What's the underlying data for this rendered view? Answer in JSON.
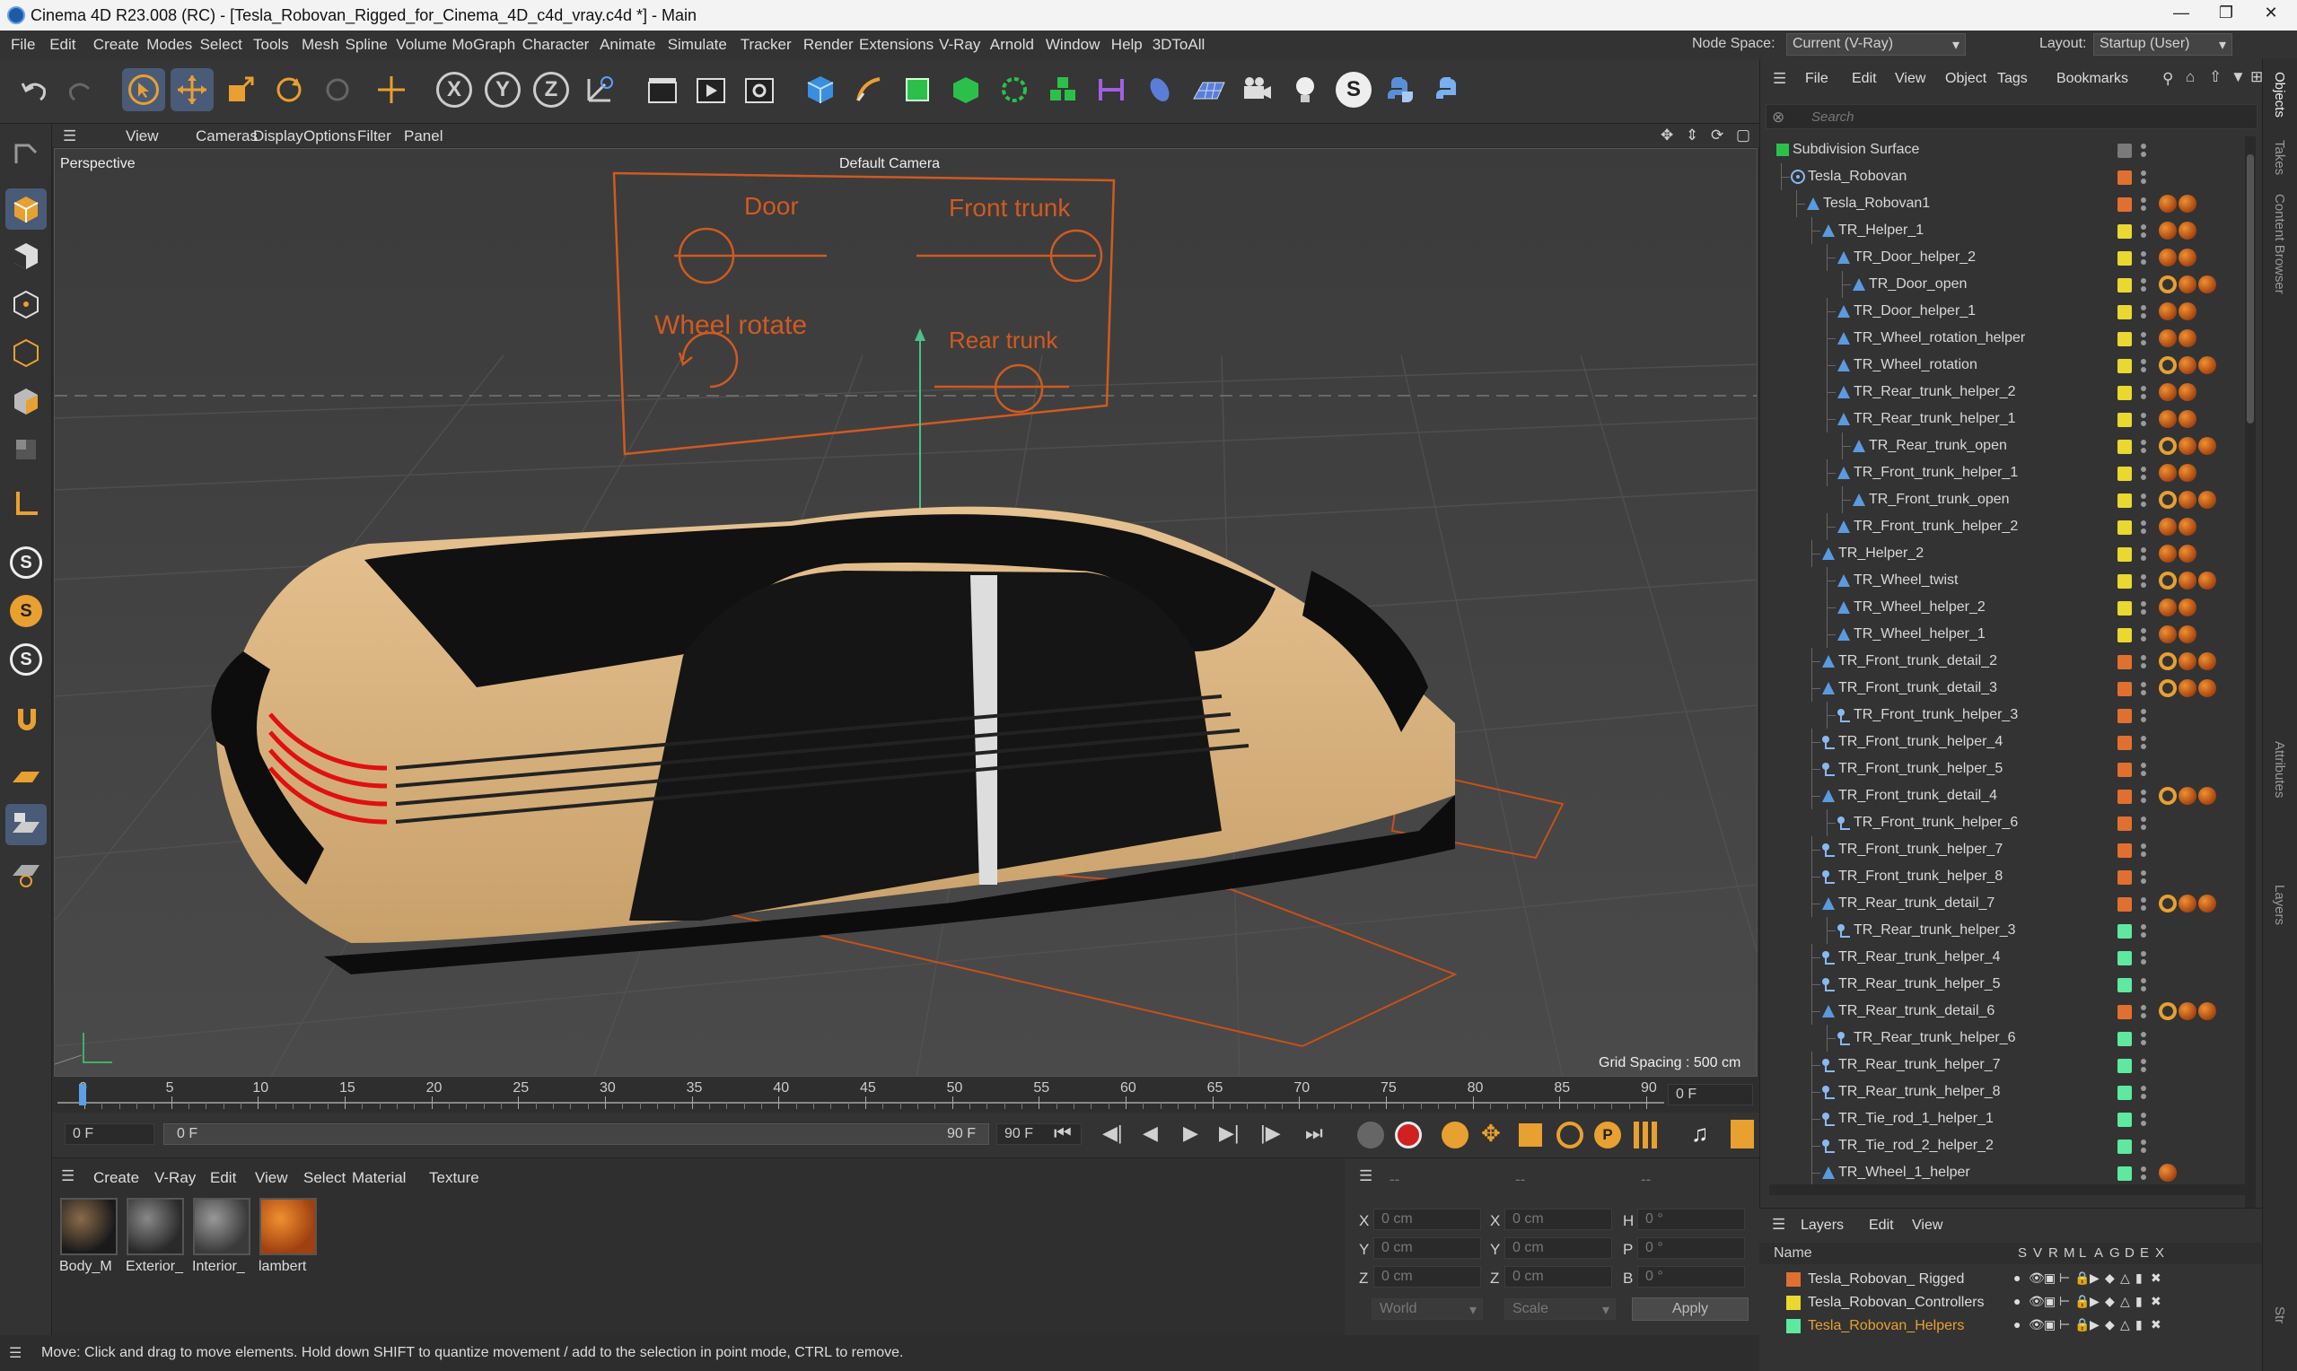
{
  "window": {
    "title": "Cinema 4D R23.008 (RC) - [Tesla_Robovan_Rigged_for_Cinema_4D_c4d_vray.c4d *] - Main"
  },
  "menu": [
    "File",
    "Edit",
    "Create",
    "Modes",
    "Select",
    "Tools",
    "Mesh",
    "Spline",
    "Volume",
    "MoGraph",
    "Character",
    "Animate",
    "Simulate",
    "Tracker",
    "Render",
    "Extensions",
    "V-Ray",
    "Arnold",
    "Window",
    "Help",
    "3DToAll"
  ],
  "nodespace": {
    "label": "Node Space:",
    "value": "Current (V-Ray)"
  },
  "layout": {
    "label": "Layout:",
    "value": "Startup (User)"
  },
  "viewport": {
    "menu": [
      "View",
      "Cameras",
      "Display",
      "Options",
      "Filter",
      "Panel"
    ],
    "name": "Perspective",
    "camera": "Default Camera",
    "grid_spacing": "Grid Spacing : 500 cm"
  },
  "controller": {
    "door": "Door",
    "front_trunk": "Front trunk",
    "wheel_rotate": "Wheel rotate",
    "rear_trunk": "Rear trunk"
  },
  "timeline": {
    "ticks": [
      "0",
      "5",
      "10",
      "15",
      "20",
      "25",
      "30",
      "35",
      "40",
      "45",
      "50",
      "55",
      "60",
      "65",
      "70",
      "75",
      "80",
      "85",
      "90"
    ],
    "current": "0 F"
  },
  "playback": {
    "start": "0 F",
    "range_start": "0 F",
    "range_end": "90 F",
    "end": "90 F"
  },
  "materials": {
    "menu": [
      "Create",
      "V-Ray",
      "Edit",
      "View",
      "Select",
      "Material",
      "Texture"
    ],
    "items": [
      {
        "name": "Body_M"
      },
      {
        "name": "Exterior_"
      },
      {
        "name": "Interior_"
      },
      {
        "name": "lambert"
      }
    ]
  },
  "coords": {
    "dash1": "--",
    "dash2": "--",
    "dash3": "--",
    "x": "X",
    "y": "Y",
    "z": "Z",
    "h": "H",
    "p": "P",
    "b": "B",
    "pos_x": "0 cm",
    "pos_y": "0 cm",
    "pos_z": "0 cm",
    "sx": "0 cm",
    "sy": "0 cm",
    "sz": "0 cm",
    "rh": "0 °",
    "rp": "0 °",
    "rb": "0 °",
    "world": "World",
    "scale": "Scale",
    "apply": "Apply"
  },
  "status": "Move: Click and drag to move elements. Hold down SHIFT to quantize movement / add to the selection in point mode, CTRL to remove.",
  "objects": {
    "menu": [
      "File",
      "Edit",
      "View",
      "Object",
      "Tags",
      "Bookmarks"
    ],
    "search": "Search",
    "rows": [
      {
        "name": "Subdivision Surface",
        "indent": 0,
        "icon": "subd",
        "layer": "#7a7a7a"
      },
      {
        "name": "Tesla_Robovan",
        "indent": 1,
        "icon": "null",
        "layer": "#e07030"
      },
      {
        "name": "Tesla_Robovan1",
        "indent": 2,
        "icon": "joint",
        "layer": "#e07030",
        "tags": 2
      },
      {
        "name": "TR_Helper_1",
        "indent": 3,
        "icon": "joint",
        "layer": "#e8d830",
        "tags": 2
      },
      {
        "name": "TR_Door_helper_2",
        "indent": 4,
        "icon": "joint",
        "layer": "#e8d830",
        "tags": 2
      },
      {
        "name": "TR_Door_open",
        "indent": 5,
        "icon": "joint",
        "layer": "#e8d830",
        "tags": 3
      },
      {
        "name": "TR_Door_helper_1",
        "indent": 4,
        "icon": "joint",
        "layer": "#e8d830",
        "tags": 2
      },
      {
        "name": "TR_Wheel_rotation_helper",
        "indent": 4,
        "icon": "joint",
        "layer": "#e8d830",
        "tags": 2
      },
      {
        "name": "TR_Wheel_rotation",
        "indent": 4,
        "icon": "joint",
        "layer": "#e8d830",
        "tags": 3
      },
      {
        "name": "TR_Rear_trunk_helper_2",
        "indent": 4,
        "icon": "joint",
        "layer": "#e8d830",
        "tags": 2
      },
      {
        "name": "TR_Rear_trunk_helper_1",
        "indent": 4,
        "icon": "joint",
        "layer": "#e8d830",
        "tags": 2
      },
      {
        "name": "TR_Rear_trunk_open",
        "indent": 5,
        "icon": "joint",
        "layer": "#e8d830",
        "tags": 3
      },
      {
        "name": "TR_Front_trunk_helper_1",
        "indent": 4,
        "icon": "joint",
        "layer": "#e8d830",
        "tags": 2
      },
      {
        "name": "TR_Front_trunk_open",
        "indent": 5,
        "icon": "joint",
        "layer": "#e8d830",
        "tags": 3
      },
      {
        "name": "TR_Front_trunk_helper_2",
        "indent": 4,
        "icon": "joint",
        "layer": "#e8d830",
        "tags": 2
      },
      {
        "name": "TR_Helper_2",
        "indent": 3,
        "icon": "joint",
        "layer": "#e8d830",
        "tags": 2
      },
      {
        "name": "TR_Wheel_twist",
        "indent": 4,
        "icon": "joint",
        "layer": "#e8d830",
        "tags": 3
      },
      {
        "name": "TR_Wheel_helper_2",
        "indent": 4,
        "icon": "joint",
        "layer": "#e8d830",
        "tags": 2
      },
      {
        "name": "TR_Wheel_helper_1",
        "indent": 4,
        "icon": "joint",
        "layer": "#e8d830",
        "tags": 2
      },
      {
        "name": "TR_Front_trunk_detail_2",
        "indent": 3,
        "icon": "joint",
        "layer": "#e07030",
        "tags": 3
      },
      {
        "name": "TR_Front_trunk_detail_3",
        "indent": 3,
        "icon": "joint",
        "layer": "#e07030",
        "tags": 3
      },
      {
        "name": "TR_Front_trunk_helper_3",
        "indent": 4,
        "icon": "bone",
        "layer": "#e07030"
      },
      {
        "name": "TR_Front_trunk_helper_4",
        "indent": 3,
        "icon": "bone",
        "layer": "#e07030"
      },
      {
        "name": "TR_Front_trunk_helper_5",
        "indent": 3,
        "icon": "bone",
        "layer": "#e07030"
      },
      {
        "name": "TR_Front_trunk_detail_4",
        "indent": 3,
        "icon": "joint",
        "layer": "#e07030",
        "tags": 3
      },
      {
        "name": "TR_Front_trunk_helper_6",
        "indent": 4,
        "icon": "bone",
        "layer": "#e07030"
      },
      {
        "name": "TR_Front_trunk_helper_7",
        "indent": 3,
        "icon": "bone",
        "layer": "#e07030"
      },
      {
        "name": "TR_Front_trunk_helper_8",
        "indent": 3,
        "icon": "bone",
        "layer": "#e07030"
      },
      {
        "name": "TR_Rear_trunk_detail_7",
        "indent": 3,
        "icon": "joint",
        "layer": "#e07030",
        "tags": 3
      },
      {
        "name": "TR_Rear_trunk_helper_3",
        "indent": 4,
        "icon": "bone",
        "layer": "#5ee8a0"
      },
      {
        "name": "TR_Rear_trunk_helper_4",
        "indent": 3,
        "icon": "bone",
        "layer": "#5ee8a0"
      },
      {
        "name": "TR_Rear_trunk_helper_5",
        "indent": 3,
        "icon": "bone",
        "layer": "#5ee8a0"
      },
      {
        "name": "TR_Rear_trunk_detail_6",
        "indent": 3,
        "icon": "joint",
        "layer": "#e07030",
        "tags": 3
      },
      {
        "name": "TR_Rear_trunk_helper_6",
        "indent": 4,
        "icon": "bone",
        "layer": "#5ee8a0"
      },
      {
        "name": "TR_Rear_trunk_helper_7",
        "indent": 3,
        "icon": "bone",
        "layer": "#5ee8a0"
      },
      {
        "name": "TR_Rear_trunk_helper_8",
        "indent": 3,
        "icon": "bone",
        "layer": "#5ee8a0"
      },
      {
        "name": "TR_Tie_rod_1_helper_1",
        "indent": 3,
        "icon": "bone",
        "layer": "#5ee8a0"
      },
      {
        "name": "TR_Tie_rod_2_helper_2",
        "indent": 3,
        "icon": "bone",
        "layer": "#5ee8a0"
      },
      {
        "name": "TR_Wheel_1_helper",
        "indent": 3,
        "icon": "joint",
        "layer": "#5ee8a0",
        "tags": 1
      }
    ]
  },
  "layers": {
    "menu": [
      "Layers",
      "Edit",
      "View"
    ],
    "header": {
      "name": "Name",
      "cols": [
        "S",
        "V",
        "R",
        "M",
        "L",
        "A",
        "G",
        "D",
        "E",
        "X"
      ]
    },
    "items": [
      {
        "name": "Tesla_Robovan_ Rigged",
        "color": "#e07030"
      },
      {
        "name": "Tesla_Robovan_Controllers",
        "color": "#e8d830"
      },
      {
        "name": "Tesla_Robovan_Helpers",
        "color": "#5ee8a0",
        "active": true
      }
    ]
  },
  "sidetabs": [
    "Objects",
    "Takes",
    "Content Browser",
    "Attributes",
    "Layers",
    "Str"
  ]
}
